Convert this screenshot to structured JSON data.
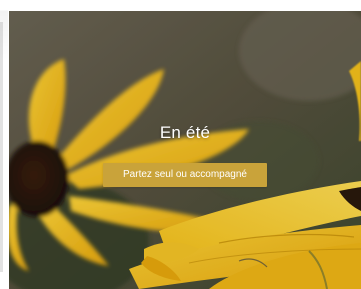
{
  "slide": {
    "title": "En été",
    "button_label": "Partez seul ou accompagné"
  },
  "colors": {
    "button_background": "#c9a33a",
    "title_text": "#ffffff",
    "background_photo": "#5f5a4c",
    "petal_yellow": "#f2c213"
  },
  "image": {
    "subject": "yellow-flower-petals-photo"
  }
}
